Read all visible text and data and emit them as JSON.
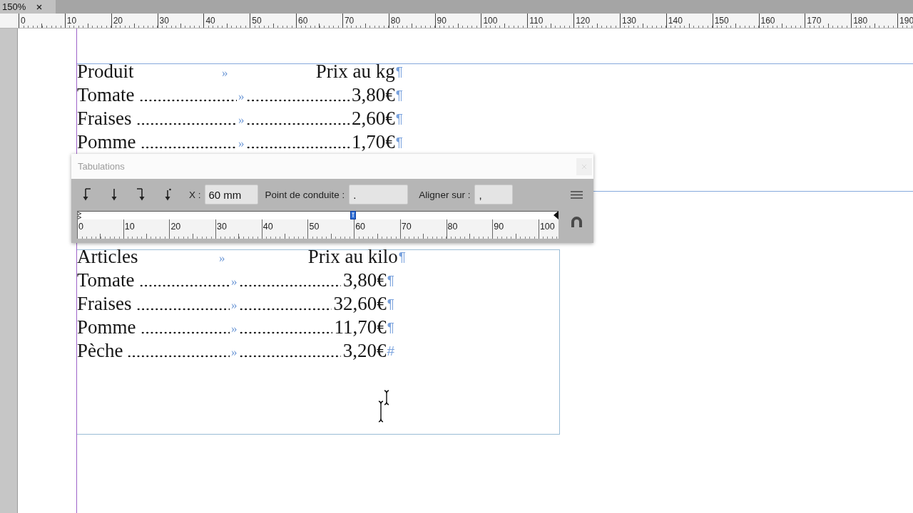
{
  "document_tab": {
    "label": "150%"
  },
  "ruler": {
    "labels": [
      "0",
      "10",
      "20",
      "30",
      "40",
      "50",
      "60",
      "70",
      "80",
      "90",
      "100",
      "110",
      "120",
      "130",
      "140",
      "150",
      "160",
      "170",
      "180",
      "190"
    ]
  },
  "frames": [
    {
      "header": {
        "label": "Produit",
        "tab_mark": "»",
        "heading": "Prix au kg",
        "end_mark": "¶"
      },
      "rows": [
        {
          "label": "Tomate",
          "tab_mark": "»",
          "price": "3,80€",
          "end_mark": "¶"
        },
        {
          "label": "Fraises",
          "tab_mark": "»",
          "price": "2,60€",
          "end_mark": "¶"
        },
        {
          "label": "Pomme",
          "tab_mark": "»",
          "price": "1,70€",
          "end_mark": "¶"
        }
      ]
    },
    {
      "header": {
        "label": "Articles",
        "tab_mark": "»",
        "heading": "Prix au kilo",
        "end_mark": "¶"
      },
      "rows": [
        {
          "label": "Tomate",
          "tab_mark": "»",
          "price": "3,80€",
          "end_mark": "¶"
        },
        {
          "label": "Fraises",
          "tab_mark": "»",
          "price": "32,60€",
          "end_mark": "¶"
        },
        {
          "label": "Pomme",
          "tab_mark": "»",
          "price": "11,70€",
          "end_mark": "¶"
        },
        {
          "label": "Pèche",
          "tab_mark": "»",
          "price": "3,20€",
          "end_mark": "#"
        }
      ]
    }
  ],
  "tabs_panel": {
    "title": "Tabulations",
    "tab_types": [
      {
        "kind": "left"
      },
      {
        "kind": "center"
      },
      {
        "kind": "right"
      },
      {
        "kind": "decimal"
      }
    ],
    "position": {
      "label": "X :",
      "value": "60 mm"
    },
    "leader": {
      "label": "Point de conduite :",
      "value": "."
    },
    "align_on": {
      "label": "Aligner sur :",
      "value": ","
    },
    "ruler": {
      "labels": [
        "0",
        "10",
        "20",
        "30",
        "40",
        "50",
        "60",
        "70",
        "80",
        "90",
        "100"
      ]
    },
    "tab_stops": [
      {
        "level": 0.573,
        "selected": true
      }
    ]
  }
}
